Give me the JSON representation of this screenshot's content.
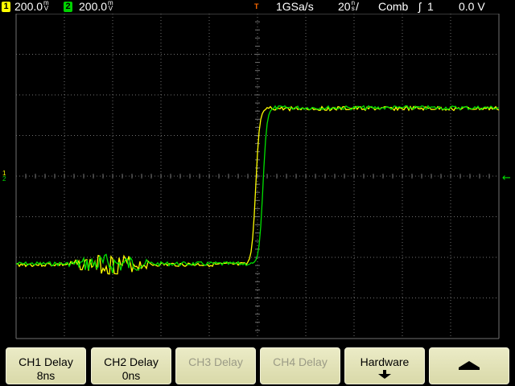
{
  "status": {
    "ch1": {
      "num": "1",
      "scale": "200.0",
      "unit_top": "m",
      "unit_bottom": "V",
      "color": "#ffff00"
    },
    "ch2": {
      "num": "2",
      "scale": "200.0",
      "unit_top": "m",
      "unit_bottom": "V",
      "color": "#00d200"
    },
    "trigger_pos_marker": "T",
    "sample_rate": "1GSa/s",
    "timebase": "20",
    "timebase_unit_top": "n",
    "timebase_unit_bottom": "s",
    "acq_mode": "Comb",
    "trig_slope": "ʃ",
    "trig_source": "1",
    "trig_level": "0.0 V"
  },
  "screen": {
    "ground_marker_left": "1",
    "ground_marker_left2": "2",
    "trigger_level_marker": "←",
    "colors": {
      "grid": "#707070",
      "ch1": "#ffff00",
      "ch2": "#00e000",
      "trigger": "#ff6a00"
    }
  },
  "softkeys": [
    {
      "line1": "CH1 Delay",
      "line2": "8ns",
      "enabled": true
    },
    {
      "line1": "CH2 Delay",
      "line2": "0ns",
      "enabled": true
    },
    {
      "line1": "CH3 Delay",
      "line2": "",
      "enabled": false
    },
    {
      "line1": "CH4 Delay",
      "line2": "",
      "enabled": false
    },
    {
      "line1": "Hardware",
      "line2": "",
      "enabled": true,
      "icon": "arrow-down-icon"
    },
    {
      "line1": "",
      "line2": "",
      "enabled": true,
      "icon": "arrow-up-icon"
    }
  ]
}
